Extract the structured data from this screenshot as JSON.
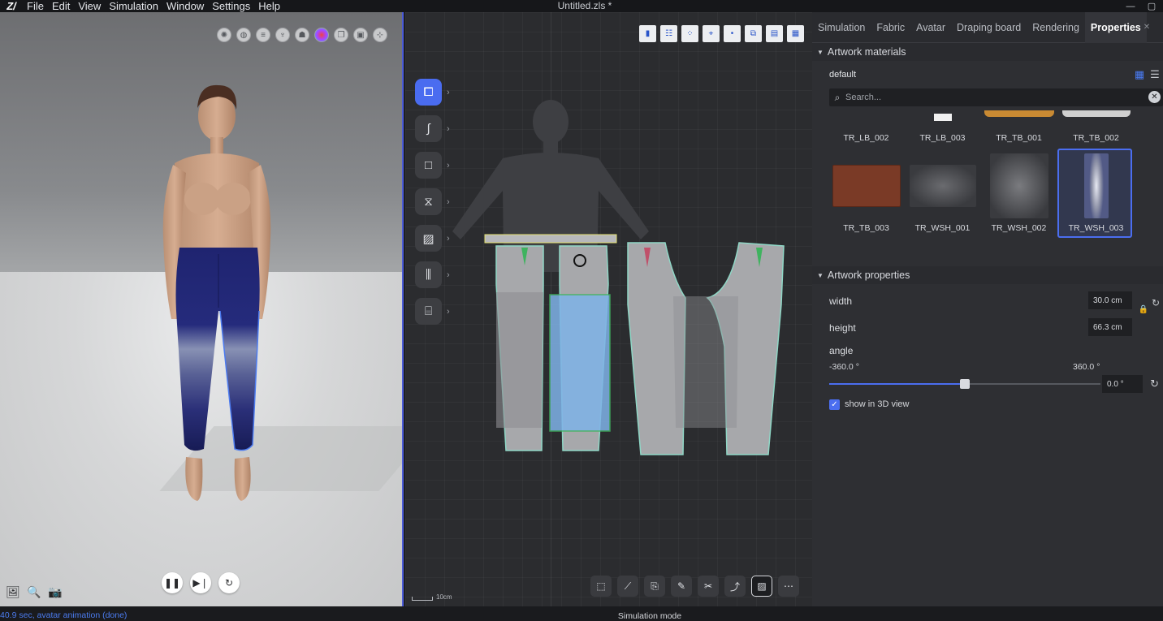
{
  "app": {
    "logo": "Z/",
    "menu": [
      "File",
      "Edit",
      "View",
      "Simulation",
      "Window",
      "Settings",
      "Help"
    ],
    "title": "Untitled.zls *"
  },
  "window_controls": [
    "minimize-icon",
    "maximize-icon"
  ],
  "viewport3d": {
    "toolbar_icons": [
      "particle-icon",
      "sphere-icon",
      "layers-icon",
      "avatar-pose-icon",
      "avatar-icon",
      "color-wheel-icon",
      "copy-icon",
      "camera-frame-icon",
      "gizmo-icon"
    ],
    "playback": [
      "pause-icon",
      "step-forward-icon",
      "refresh-icon"
    ],
    "bottom_left_icons": [
      "screenshot-icon",
      "zoom-view-icon",
      "camera-icon"
    ]
  },
  "view2d": {
    "top_icons": [
      "view-3d-icon",
      "pattern-list-icon",
      "show-points-icon",
      "show-seams-icon",
      "show-dot-icon",
      "show-internal-icon",
      "show-texture-icon",
      "show-grid-icon"
    ],
    "side_tools": [
      "transform-pattern-icon",
      "curve-icon",
      "rectangle-icon",
      "sewing-icon",
      "artwork-icon",
      "fold-icon",
      "measure-icon"
    ],
    "bottom_tools": [
      "select-pattern-icon",
      "edit-segment-icon",
      "trace-icon",
      "add-point-icon",
      "cut-icon",
      "edit-curve-icon",
      "artwork-transform-icon",
      "sew-line-icon"
    ],
    "scale_label": "10cm"
  },
  "rightpanel": {
    "tabs": [
      "Simulation",
      "Fabric",
      "Avatar",
      "Draping board",
      "Rendering",
      "Properties"
    ],
    "active_tab": "Properties",
    "artwork_materials": {
      "header": "Artwork materials",
      "preset": "default",
      "search_placeholder": "Search...",
      "items": [
        {
          "label": "TR_LB_002",
          "swatch": "#3a3b3f"
        },
        {
          "label": "TR_LB_003",
          "swatch": "#f1f1f1"
        },
        {
          "label": "TR_TB_001",
          "swatch": "#c98a33"
        },
        {
          "label": "TR_TB_002",
          "swatch": "#cfcfcf"
        },
        {
          "label": "TR_TB_003",
          "swatch": "#7a3a26"
        },
        {
          "label": "TR_WSH_001",
          "swatch": "#55575b"
        },
        {
          "label": "TR_WSH_002",
          "swatch": "#606165"
        },
        {
          "label": "TR_WSH_003",
          "swatch": "#8f93a8"
        }
      ],
      "selected": "TR_WSH_003"
    },
    "artwork_properties": {
      "header": "Artwork properties",
      "width_label": "width",
      "width_value": "30.0 cm",
      "height_label": "height",
      "height_value": "66.3 cm",
      "angle_label": "angle",
      "angle_min": "-360.0 °",
      "angle_max": "360.0 °",
      "angle_value": "0.0 °",
      "angle_fraction": 0.5,
      "show3d_label": "show in 3D view",
      "show3d_checked": true
    }
  },
  "status": {
    "left": "40.9 sec, avatar animation (done)",
    "center": "Simulation mode"
  },
  "colors": {
    "accent": "#4b6ef0",
    "status_text": "#4b7cf0"
  }
}
